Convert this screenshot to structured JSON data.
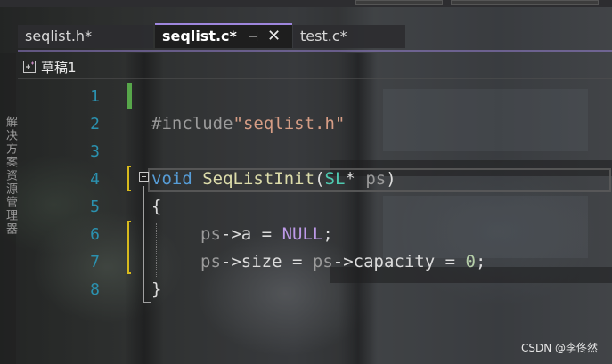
{
  "tabs": [
    {
      "label": "seqlist.h*",
      "active": false
    },
    {
      "label": "seqlist.c*",
      "active": true
    },
    {
      "label": "test.c*",
      "active": false
    }
  ],
  "side_panel_text": "解决方案资源管理器",
  "project": {
    "name": "草稿1"
  },
  "code_lines": [
    {
      "number": "1",
      "text": ""
    },
    {
      "number": "2",
      "text": "#include\"seqlist.h\""
    },
    {
      "number": "3",
      "text": ""
    },
    {
      "number": "4",
      "text": "void SeqListInit(SL* ps)"
    },
    {
      "number": "5",
      "text": "{"
    },
    {
      "number": "6",
      "text": "ps->a = NULL;"
    },
    {
      "number": "7",
      "text": "ps->size = ps->capacity = 0;"
    },
    {
      "number": "8",
      "text": "}"
    }
  ],
  "tokens": {
    "include_kw": "#include",
    "include_file": "\"seqlist.h\"",
    "void": "void",
    "func": "SeqListInit",
    "lparen": "(",
    "type": "SL",
    "star": "*",
    "param": "ps",
    "rparen": ")",
    "lbrace": "{",
    "rbrace": "}",
    "l6_ps": "ps",
    "l6_arrow": "->",
    "l6_field": "a",
    "l6_eq": " = ",
    "l6_null": "NULL",
    "l6_semi": ";",
    "l7_ps1": "ps",
    "l7_arrow1": "->",
    "l7_field1": "size",
    "l7_eq1": " = ",
    "l7_ps2": "ps",
    "l7_arrow2": "->",
    "l7_field2": "capacity",
    "l7_eq2": " = ",
    "l7_zero": "0",
    "l7_semi": ";"
  },
  "watermark": "CSDN @李佟然",
  "colors": {
    "active_tab_accent": "#9e86dd",
    "line_number": "#2b91af",
    "keyword": "#569cd6",
    "string": "#d69d85",
    "type": "#4ec9b0",
    "function": "#dcdcaa",
    "macro": "#bd9ae8",
    "number": "#b5cea8",
    "saved_change_bar": "#57a64a",
    "unsaved_change_bar": "#d7ba1d"
  },
  "icons": {
    "pin": "pin-icon",
    "close": "close-icon",
    "project": "project-icon",
    "collapse": "collapse-icon"
  }
}
